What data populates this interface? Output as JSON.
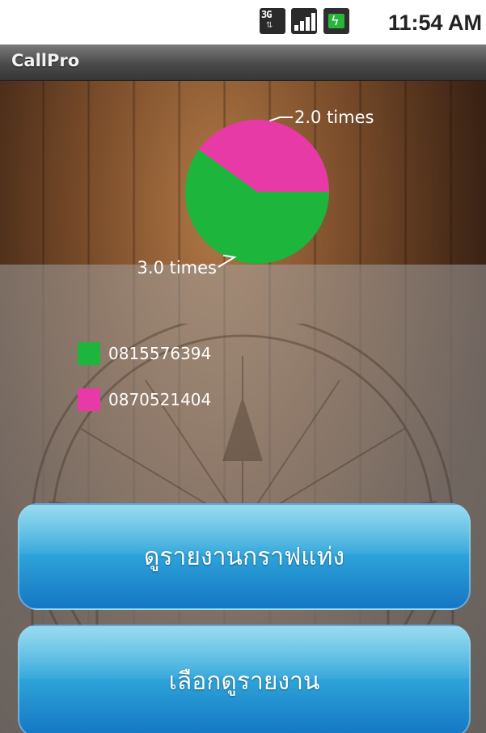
{
  "status_bar": {
    "network_label": "3G",
    "time": "11:54 AM",
    "icons": [
      "network-3g-icon",
      "signal-strength-icon",
      "battery-charging-icon"
    ]
  },
  "app": {
    "title": "CallPro"
  },
  "chart_data": {
    "type": "pie",
    "slices": [
      {
        "name": "0815576394",
        "value": 3.0,
        "label": "3.0 times",
        "color": "#1db53c"
      },
      {
        "name": "0870521404",
        "value": 2.0,
        "label": "2.0 times",
        "color": "#e83aa7"
      }
    ],
    "legend_placement": "bottom-left"
  },
  "legend": {
    "items": [
      {
        "label": "0815576394",
        "color": "#1db53c"
      },
      {
        "label": "0870521404",
        "color": "#e83aa7"
      }
    ]
  },
  "buttons": {
    "bar_report": "ดูรายงานกราฟแท่ง",
    "select_report": "เลือกดูรายงาน"
  },
  "colors": {
    "button_gradient_top": "#62c7e8",
    "button_gradient_bottom": "#1476c4"
  }
}
